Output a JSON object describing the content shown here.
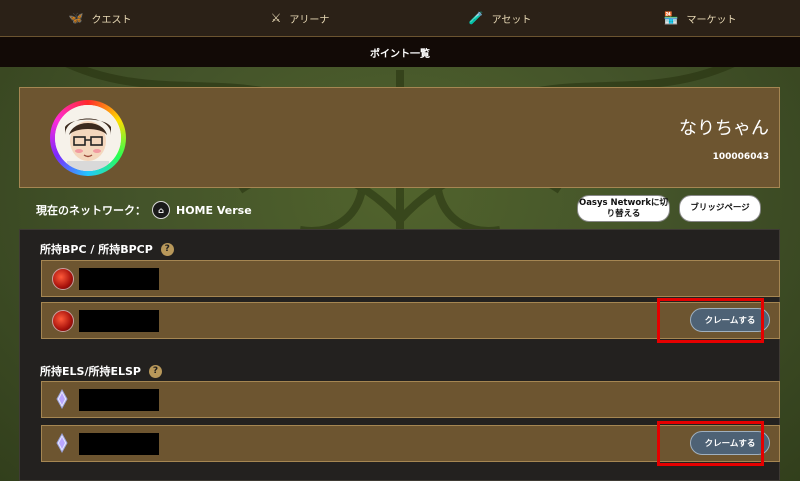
{
  "nav": {
    "items": [
      {
        "label": "クエスト",
        "icon": "quest-icon"
      },
      {
        "label": "アリーナ",
        "icon": "arena-icon"
      },
      {
        "label": "アセット",
        "icon": "asset-icon"
      },
      {
        "label": "マーケット",
        "icon": "market-icon"
      }
    ]
  },
  "subbar": {
    "title": "ポイント一覧"
  },
  "profile": {
    "name": "なりちゃん",
    "id": "100006043"
  },
  "network": {
    "label": "現在のネットワーク：",
    "name": "HOME Verse"
  },
  "buttons": {
    "switch_label": "Oasys Networkに切り替える",
    "bridge_label": "ブリッジページ"
  },
  "sections": [
    {
      "title": "所持BPC / 所持BPCP",
      "help": "?",
      "claim_label": "クレームする"
    },
    {
      "title": "所持ELS/所持ELSP",
      "help": "?",
      "claim_label": "クレームする"
    }
  ],
  "colors": {
    "highlight": "#e50000",
    "row_bg": "#6d5530",
    "claim_bg": "#4e6275"
  }
}
